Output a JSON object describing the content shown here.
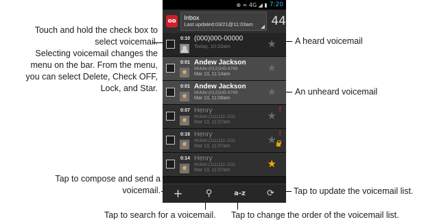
{
  "status_bar": {
    "icons": "⊕ ≈ 4G ◢ ▮",
    "time": "7:20"
  },
  "header": {
    "title": "Inbox",
    "subtitle": "Last updated:03/21@11:03am",
    "count": "44",
    "logo": "oo"
  },
  "voicemails": [
    {
      "duration": "0:10",
      "name": "(000)000-00000",
      "detail": "",
      "date": "Today, 10:33am",
      "starred": false,
      "urgent": false,
      "locked": false,
      "thumb": "blank-avatar"
    },
    {
      "duration": "0:01",
      "name": "Andew Jackson",
      "detail": "Mobile:(012)345-6789",
      "date": "Mar 13, 11:14am",
      "starred": false,
      "urgent": false,
      "locked": false,
      "thumb": "contact-photo"
    },
    {
      "duration": "0:01",
      "name": "Andew Jackson",
      "detail": "Mobile:(012)345-6789",
      "date": "Mar 13, 11:08am",
      "starred": false,
      "urgent": false,
      "locked": false,
      "thumb": "contact-photo"
    },
    {
      "duration": "0:07",
      "name": "Henry",
      "detail": "Mobile:(111)111-1111",
      "date": "Mar 13, 11:07am",
      "starred": false,
      "urgent": true,
      "locked": false,
      "thumb": "contact-photo"
    },
    {
      "duration": "0:16",
      "name": "Henry",
      "detail": "Mobile:(111)111-1111",
      "date": "Mar 13, 11:07am",
      "starred": false,
      "urgent": true,
      "locked": true,
      "thumb": "contact-photo"
    },
    {
      "duration": "0:14",
      "name": "Henry",
      "detail": "Mobile:(111)111-1111",
      "date": "Mar 13, 11:07am",
      "starred": true,
      "urgent": false,
      "locked": false,
      "thumb": "contact-photo"
    }
  ],
  "bottom_bar": {
    "compose": "+",
    "search": "⚲",
    "sort": "a-z",
    "refresh": "⟳"
  },
  "annotations": {
    "checkbox_line1": "Touch and hold the check box to",
    "checkbox_line2": "select voicemail.",
    "checkbox_line3": "Selecting voicemail changes the",
    "checkbox_line4": "menu on the bar. From the menu,",
    "checkbox_line5": "you can select Delete, Check OFF,",
    "checkbox_line6": "Lock, and Star.",
    "heard": "A heard voicemail",
    "unheard": "An unheard voicemail",
    "compose_line1": "Tap to compose and send a",
    "compose_line2": "voicemail.",
    "update": "Tap to update the voicemail list.",
    "search": "Tap to search for a voicemail.",
    "order": "Tap to change the order of the voicemail list."
  },
  "colors": {
    "accent": "#33b5e5",
    "star_on": "#ffa800",
    "urgent": "#e0242a",
    "logo": "#d0202a"
  }
}
